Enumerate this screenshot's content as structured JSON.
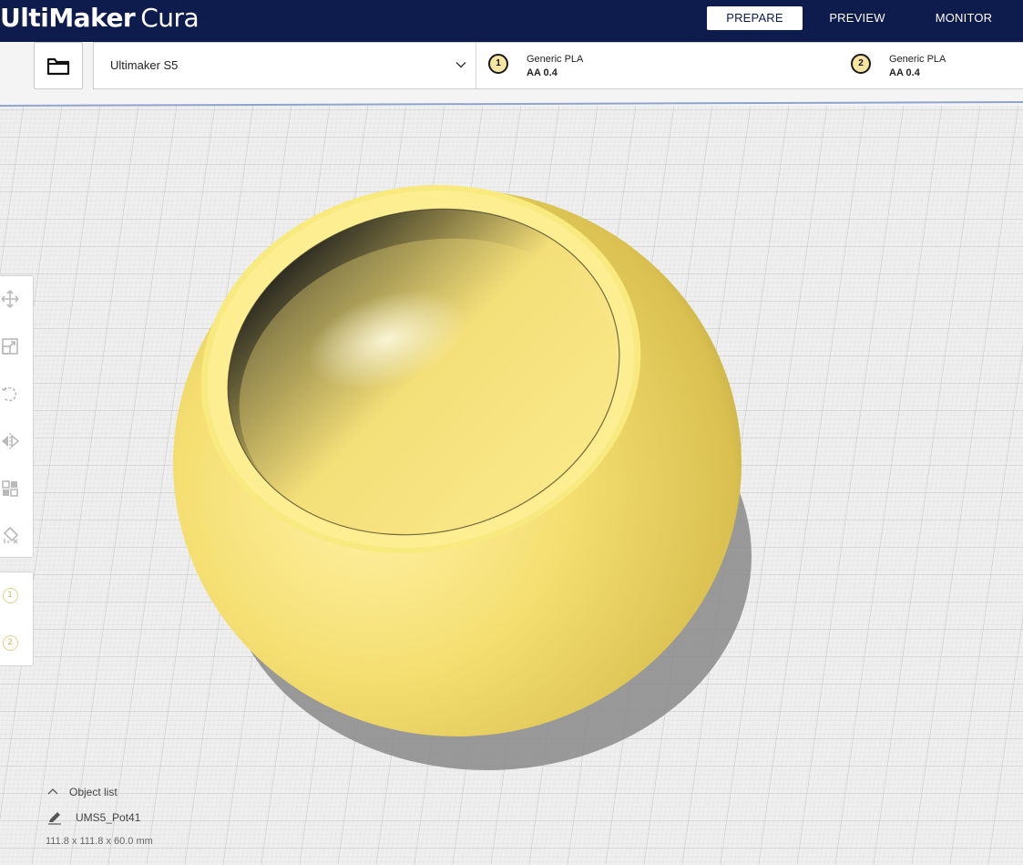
{
  "app": {
    "brand": "UltiMaker",
    "name": "Cura"
  },
  "nav": {
    "prepare": "PREPARE",
    "preview": "PREVIEW",
    "monitor": "MONITOR"
  },
  "printer": {
    "name": "Ultimaker S5"
  },
  "extruders": [
    {
      "index": "1",
      "material": "Generic PLA",
      "core": "AA 0.4"
    },
    {
      "index": "2",
      "material": "Generic PLA",
      "core": "AA 0.4"
    }
  ],
  "tools": [
    "move-icon",
    "scale-icon",
    "rotate-icon",
    "mirror-icon",
    "per-model-settings-icon",
    "support-blocker-icon"
  ],
  "tool_extruders": [
    "1",
    "2"
  ],
  "object_list": {
    "header": "Object list",
    "object_name": "UMS5_Pot41",
    "dimensions": "111.8 x 111.8 x 60.0 mm"
  },
  "colors": {
    "header_bg": "#0e1b4d",
    "model_yellow": "#f7e27a",
    "build_plate": "#f0f0f0",
    "grid_line": "#c8c8c8"
  }
}
